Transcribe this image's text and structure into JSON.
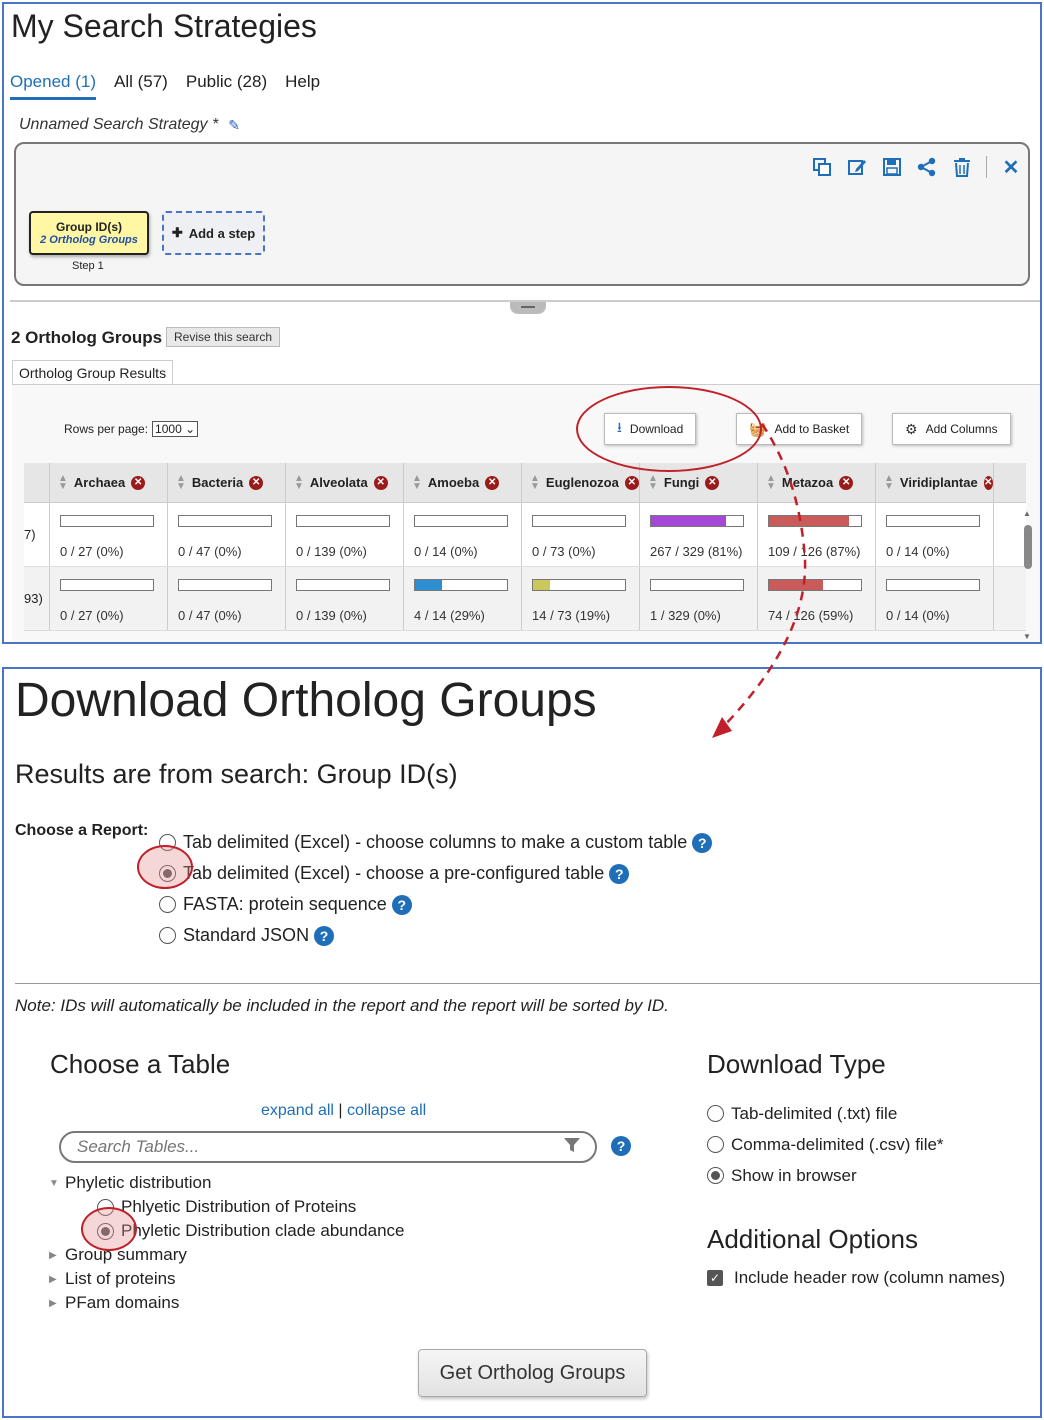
{
  "top": {
    "page_title": "My Search Strategies",
    "tabs": [
      {
        "label": "Opened (1)",
        "active": true
      },
      {
        "label": "All (57)",
        "active": false
      },
      {
        "label": "Public (28)",
        "active": false
      },
      {
        "label": "Help",
        "active": false
      }
    ],
    "strategy_name": "Unnamed Search Strategy *",
    "toolbar_icons": [
      "copy-icon",
      "edit-icon",
      "save-icon",
      "share-icon",
      "delete-icon",
      "close-icon"
    ],
    "step": {
      "name": "Group ID(s)",
      "desc": "2 Ortholog Groups",
      "label": "Step 1"
    },
    "add_step_label": "Add a step",
    "results_title": "2 Ortholog Groups",
    "revise_label": "Revise this search",
    "results_tab": "Ortholog Group Results",
    "rows_per_page_label": "Rows per page:",
    "rows_per_page_value": "1000",
    "download_label": "Download",
    "basket_label": "Add to Basket",
    "add_columns_label": "Add Columns",
    "columns": [
      "Archaea",
      "Bacteria",
      "Alveolata",
      "Amoeba",
      "Euglenozoa",
      "Fungi",
      "Metazoa",
      "Viridiplantae"
    ],
    "rows": [
      {
        "stub": "7)",
        "cells": [
          {
            "text": "0 / 27 (0%)",
            "fill": 0,
            "color": ""
          },
          {
            "text": "0 / 47 (0%)",
            "fill": 0,
            "color": ""
          },
          {
            "text": "0 / 139 (0%)",
            "fill": 0,
            "color": ""
          },
          {
            "text": "0 / 14 (0%)",
            "fill": 0,
            "color": ""
          },
          {
            "text": "0 / 73 (0%)",
            "fill": 0,
            "color": ""
          },
          {
            "text": "267 / 329 (81%)",
            "fill": 0.81,
            "color": "#a548d6"
          },
          {
            "text": "109 / 126 (87%)",
            "fill": 0.87,
            "color": "#c95b5b"
          },
          {
            "text": "0 / 14 (0%)",
            "fill": 0,
            "color": ""
          }
        ]
      },
      {
        "stub": "93)",
        "cells": [
          {
            "text": "0 / 27 (0%)",
            "fill": 0,
            "color": ""
          },
          {
            "text": "0 / 47 (0%)",
            "fill": 0,
            "color": ""
          },
          {
            "text": "0 / 139 (0%)",
            "fill": 0,
            "color": ""
          },
          {
            "text": "4 / 14 (29%)",
            "fill": 0.29,
            "color": "#2d8fd0"
          },
          {
            "text": "14 / 73 (19%)",
            "fill": 0.19,
            "color": "#c8c95a"
          },
          {
            "text": "1 / 329 (0%)",
            "fill": 0,
            "color": ""
          },
          {
            "text": "74 / 126 (59%)",
            "fill": 0.59,
            "color": "#c95b5b"
          },
          {
            "text": "0 / 14 (0%)",
            "fill": 0,
            "color": ""
          }
        ]
      }
    ]
  },
  "download": {
    "title": "Download Ortholog Groups",
    "subtitle": "Results are from search: Group ID(s)",
    "choose_report_label": "Choose a Report:",
    "report_options": [
      {
        "label": "Tab delimited (Excel) - choose columns to make a custom table",
        "checked": false
      },
      {
        "label": "Tab delimited (Excel) - choose a pre-configured table",
        "checked": true
      },
      {
        "label": "FASTA: protein sequence",
        "checked": false
      },
      {
        "label": "Standard JSON",
        "checked": false
      }
    ],
    "note": "Note: IDs will automatically be included in the report and the report will be sorted by ID.",
    "choose_table_title": "Choose a Table",
    "expand_all": "expand all",
    "collapse_all": "collapse all",
    "search_placeholder": "Search Tables...",
    "tree": [
      {
        "label": "Phyletic distribution",
        "expanded": true,
        "children": [
          {
            "label": "Phlyetic Distribution of Proteins",
            "checked": false
          },
          {
            "label": "Phyletic Distribution clade abundance",
            "checked": true
          }
        ]
      },
      {
        "label": "Group summary",
        "expanded": false,
        "children": []
      },
      {
        "label": "List of proteins",
        "expanded": false,
        "children": []
      },
      {
        "label": "PFam domains",
        "expanded": false,
        "children": []
      }
    ],
    "download_type_title": "Download Type",
    "download_types": [
      {
        "label": "Tab-delimited (.txt) file",
        "checked": false
      },
      {
        "label": "Comma-delimited (.csv) file*",
        "checked": false
      },
      {
        "label": "Show in browser",
        "checked": true
      }
    ],
    "additional_options_title": "Additional Options",
    "header_row_label": "Include header row (column names)",
    "header_row_checked": true,
    "get_button": "Get Ortholog Groups"
  },
  "colors": {
    "accent": "#1f6fb8",
    "annotation": "#c0202a",
    "panel_border": "#4a74c7"
  }
}
